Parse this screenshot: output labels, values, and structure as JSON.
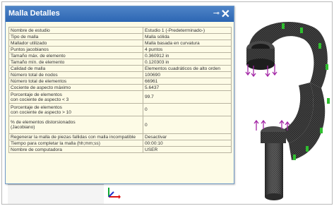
{
  "dialog": {
    "title": "Malla Detalles",
    "pin_icon": "pin-icon",
    "close_icon": "close-icon",
    "rows": [
      {
        "label": "Nombre de estudio",
        "value": "Estudio 1 (-Predeterminado-)"
      },
      {
        "label": "Tipo de malla",
        "value": "Malla sólida"
      },
      {
        "label": "Mallador utilizado",
        "value": "Malla basada en curvatura"
      },
      {
        "label": "Puntos jacobianos",
        "value": "4 puntos"
      },
      {
        "label": "Tamaño máx. de elemento",
        "value": "0.360912 in"
      },
      {
        "label": "Tamaño mín. de elemento",
        "value": "0.120303 in"
      },
      {
        "label": "Calidad de malla",
        "value": "Elementos cuadráticos de alto orden"
      },
      {
        "label": "Número total de nodos",
        "value": "100690"
      },
      {
        "label": "Número total de elementos",
        "value": "66961"
      },
      {
        "label": "Cociente de aspecto máximo",
        "value": "5.6437"
      },
      {
        "label": "Porcentaje de elementos\ncon cociente de aspecto < 3",
        "value": "99.7"
      },
      {
        "label": "Porcentaje de elementos\ncon cociente de aspecto > 10",
        "value": "0"
      },
      {
        "label": "% de elementos distorsionados\n(Jacobiano)",
        "value": "0"
      },
      {
        "label": "Regenerar la malla de piezas fallidas con malla incompatible",
        "value": "Desactivar"
      },
      {
        "label": "Tiempo para completar la malla (hh;mm;ss)",
        "value": "00:00:10"
      },
      {
        "label": "Nombre de computadora",
        "value": "USER"
      }
    ]
  },
  "viewport": {
    "axis_icon": "axis-triad-icon",
    "model_icon": "meshed-hook-model"
  }
}
